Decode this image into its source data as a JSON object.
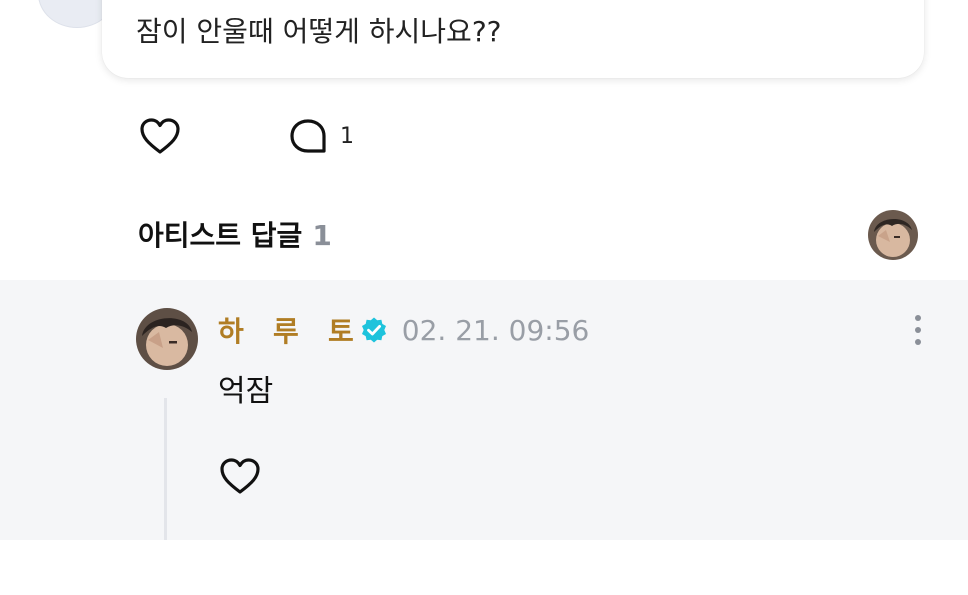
{
  "post": {
    "text": "잠이 안울때 어떻게 하시나요??",
    "like_icon": "heart-outline-icon",
    "comment_icon": "comment-bubble-icon",
    "comment_count": "1"
  },
  "artist_replies": {
    "title": "아티스트 답글",
    "count": "1"
  },
  "reply": {
    "author": "하   루   토",
    "verified_icon": "verified-badge-icon",
    "timestamp": "02. 21. 09:56",
    "text": "억잠",
    "like_icon": "heart-outline-icon",
    "more_icon": "more-vertical-icon"
  },
  "colors": {
    "author_gold": "#b07d24",
    "verified_cyan": "#1ec3dc",
    "reply_bg": "#f5f6f8",
    "muted_gray": "#999ea6"
  }
}
